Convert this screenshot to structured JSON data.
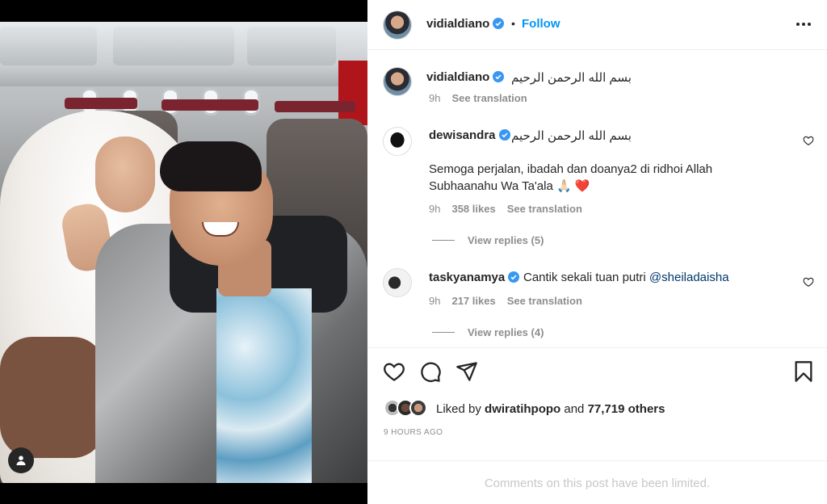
{
  "post": {
    "author": "vidialdiano",
    "follow_separator": "•",
    "follow_label": "Follow",
    "caption": "بسم الله الرحمن الرحيم",
    "caption_time": "9h",
    "caption_translate": "See translation"
  },
  "comments": [
    {
      "username": "dewisandra",
      "text_line1": "بسم الله الرحمن الرحيم",
      "text_line2": "Semoga perjalan, ibadah dan doanya2 di ridhoi Allah",
      "text_line3": "Subhaanahu Wa Ta'ala 🙏🏻 ❤️",
      "time": "9h",
      "likes": "358 likes",
      "translate": "See translation",
      "replies": "View replies (5)"
    },
    {
      "username": "taskyanamya",
      "text": "Cantik sekali tuan putri",
      "mention": "@sheiladaisha",
      "time": "9h",
      "likes": "217 likes",
      "translate": "See translation",
      "replies": "View replies (4)"
    }
  ],
  "likes": {
    "prefix": "Liked by",
    "first_liker": "dwiratihpopo",
    "conjunction": "and",
    "others": "77,719 others"
  },
  "timestamp": "9 HOURS AGO",
  "comments_limited": "Comments on this post have been limited.",
  "icons": {
    "like": "heart-icon",
    "comment": "comment-icon",
    "share": "paper-plane-icon",
    "save": "bookmark-icon",
    "more": "more-horizontal-icon",
    "verified": "verified-badge-icon",
    "tags": "user-tag-icon"
  },
  "colors": {
    "accent": "#0095f6",
    "verified": "#3897f0",
    "muted": "#8e8e8e",
    "mention": "#00376b",
    "heart_red": "#ed4956"
  }
}
